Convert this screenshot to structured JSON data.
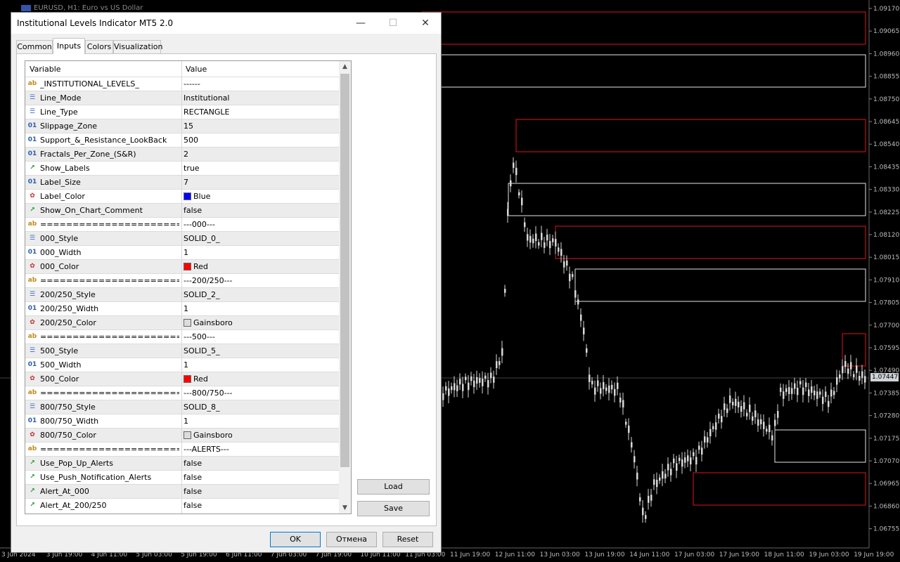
{
  "chart": {
    "title": "EURUSD, H1:  Euro vs US Dollar",
    "current_price": "1.07447",
    "price_labels": [
      "1.09170",
      "1.09065",
      "1.08960",
      "1.08855",
      "1.08750",
      "1.08645",
      "1.08540",
      "1.08435",
      "1.08330",
      "1.08225",
      "1.08120",
      "1.08015",
      "1.07910",
      "1.07805",
      "1.07700",
      "1.07595",
      "1.07490",
      "1.07385",
      "1.07280",
      "1.07175",
      "1.07070",
      "1.06965",
      "1.06860",
      "1.06755"
    ],
    "time_labels": [
      "3 Jun 2024",
      "3 Jun 19:00",
      "4 Jun 11:00",
      "5 Jun 03:00",
      "5 Jun 19:00",
      "6 Jun 11:00",
      "7 Jun 03:00",
      "7 Jun 19:00",
      "10 Jun 11:00",
      "11 Jun 03:00",
      "11 Jun 19:00",
      "12 Jun 11:00",
      "13 Jun 03:00",
      "13 Jun 19:00",
      "14 Jun 11:00",
      "17 Jun 03:00",
      "17 Jun 19:00",
      "18 Jun 11:00",
      "19 Jun 03:00",
      "19 Jun 19:00"
    ],
    "colors": {
      "red_zone": "#e0141e",
      "white_zone": "#e6e6e6",
      "candle": "#d8d8d8"
    }
  },
  "dialog": {
    "title": "Institutional Levels Indicator MT5 2.0",
    "window_buttons": {
      "minimize": "—",
      "maximize": "☐",
      "close": "✕"
    },
    "tabs": [
      "Common",
      "Inputs",
      "Colors",
      "Visualization"
    ],
    "active_tab": "Inputs",
    "grid_headers": {
      "variable": "Variable",
      "value": "Value"
    },
    "rows": [
      {
        "icon": "ab",
        "name": "_INSTITUTIONAL_LEVELS_",
        "value": "------"
      },
      {
        "icon": "enum",
        "name": "Line_Mode",
        "value": "Institutional"
      },
      {
        "icon": "enum",
        "name": "Line_Type",
        "value": "RECTANGLE"
      },
      {
        "icon": "01",
        "name": "Slippage_Zone",
        "value": "15"
      },
      {
        "icon": "01",
        "name": "Support_&_Resistance_LookBack",
        "value": "500"
      },
      {
        "icon": "01",
        "name": "Fractals_Per_Zone_(S&R)",
        "value": "2"
      },
      {
        "icon": "bool",
        "name": "Show_Labels",
        "value": "true"
      },
      {
        "icon": "01",
        "name": "Label_Size",
        "value": "7"
      },
      {
        "icon": "color",
        "name": "Label_Color",
        "value": "Blue",
        "swatch": "#0000ff"
      },
      {
        "icon": "bool",
        "name": "Show_On_Chart_Comment",
        "value": "false"
      },
      {
        "icon": "ab",
        "name": "==========================...",
        "value": "---000---"
      },
      {
        "icon": "enum",
        "name": "000_Style",
        "value": "SOLID_0_"
      },
      {
        "icon": "01",
        "name": "000_Width",
        "value": "1"
      },
      {
        "icon": "color",
        "name": "000_Color",
        "value": "Red",
        "swatch": "#ff0000"
      },
      {
        "icon": "ab",
        "name": "==========================...",
        "value": "---200/250---"
      },
      {
        "icon": "enum",
        "name": "200/250_Style",
        "value": "SOLID_2_"
      },
      {
        "icon": "01",
        "name": "200/250_Width",
        "value": "1"
      },
      {
        "icon": "color",
        "name": "200/250_Color",
        "value": "Gainsboro",
        "swatch": "#dcdcdc"
      },
      {
        "icon": "ab",
        "name": "==========================...",
        "value": "---500---"
      },
      {
        "icon": "enum",
        "name": "500_Style",
        "value": "SOLID_5_"
      },
      {
        "icon": "01",
        "name": "500_Width",
        "value": "1"
      },
      {
        "icon": "color",
        "name": "500_Color",
        "value": "Red",
        "swatch": "#ff0000"
      },
      {
        "icon": "ab",
        "name": "==========================...",
        "value": "---800/750---"
      },
      {
        "icon": "enum",
        "name": "800/750_Style",
        "value": "SOLID_8_"
      },
      {
        "icon": "01",
        "name": "800/750_Width",
        "value": "1"
      },
      {
        "icon": "color",
        "name": "800/750_Color",
        "value": "Gainsboro",
        "swatch": "#dcdcdc"
      },
      {
        "icon": "ab",
        "name": "==========================...",
        "value": "---ALERTS---"
      },
      {
        "icon": "bool",
        "name": "Use_Pop_Up_Alerts",
        "value": "false"
      },
      {
        "icon": "bool",
        "name": "Use_Push_Notification_Alerts",
        "value": "false"
      },
      {
        "icon": "bool",
        "name": "Alert_At_000",
        "value": "false"
      },
      {
        "icon": "bool",
        "name": "Alert_At_200/250",
        "value": "false"
      }
    ],
    "side_buttons": {
      "load": "Load",
      "save": "Save"
    },
    "footer_buttons": {
      "ok": "OK",
      "cancel": "Отмена",
      "reset": "Reset"
    }
  }
}
